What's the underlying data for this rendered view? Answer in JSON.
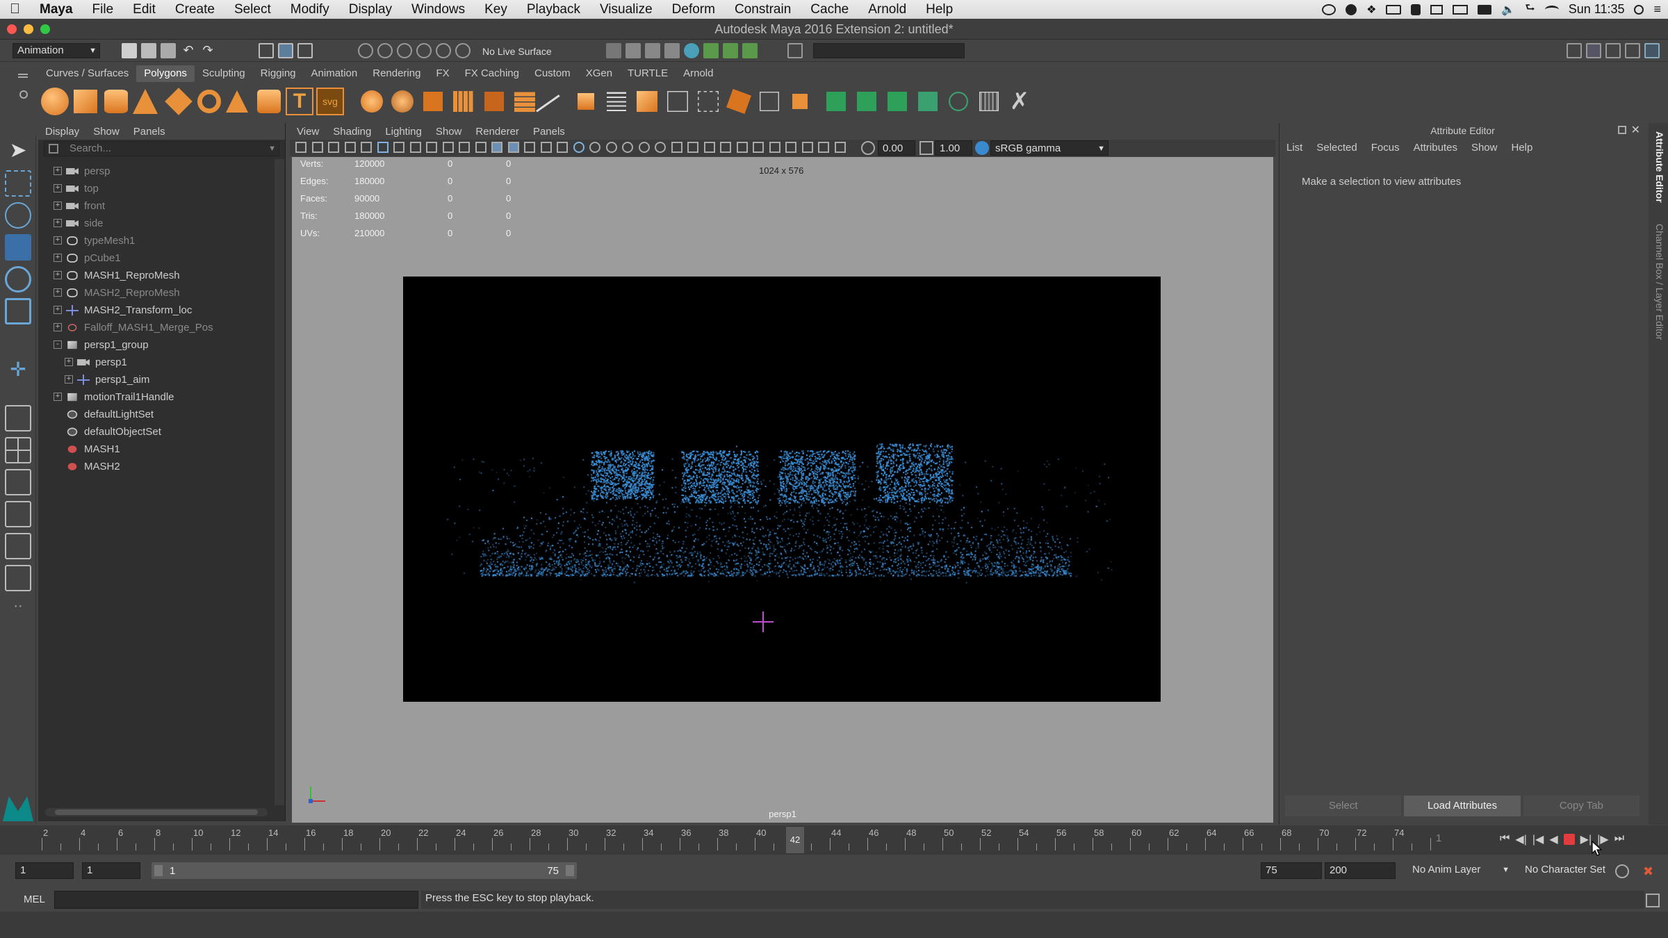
{
  "menubar": {
    "app": "Maya",
    "items": [
      "File",
      "Edit",
      "Create",
      "Select",
      "Modify",
      "Display",
      "Windows",
      "Key",
      "Playback",
      "Visualize",
      "Deform",
      "Constrain",
      "Cache",
      "Arnold",
      "Help"
    ],
    "clock": "Sun 11:35"
  },
  "window": {
    "title": "Autodesk Maya 2016 Extension 2: untitled*"
  },
  "status": {
    "mode": "Animation",
    "live_surface": "No Live Surface"
  },
  "shelf": {
    "tabs": [
      "Curves / Surfaces",
      "Polygons",
      "Sculpting",
      "Rigging",
      "Animation",
      "Rendering",
      "FX",
      "FX Caching",
      "Custom",
      "XGen",
      "TURTLE",
      "Arnold"
    ],
    "active_tab": "Polygons",
    "svg_label": "svg"
  },
  "outliner": {
    "menu": [
      "Display",
      "Show",
      "Panels"
    ],
    "search_placeholder": "Search...",
    "items": [
      {
        "label": "persp",
        "icon": "camera-icon",
        "dim": true,
        "indent": 0,
        "exp": "+"
      },
      {
        "label": "top",
        "icon": "camera-icon",
        "dim": true,
        "indent": 0,
        "exp": "+"
      },
      {
        "label": "front",
        "icon": "camera-icon",
        "dim": true,
        "indent": 0,
        "exp": "+"
      },
      {
        "label": "side",
        "icon": "camera-icon",
        "dim": true,
        "indent": 0,
        "exp": "+"
      },
      {
        "label": "typeMesh1",
        "icon": "mesh-icon",
        "dim": true,
        "indent": 0,
        "exp": "+"
      },
      {
        "label": "pCube1",
        "icon": "mesh-icon",
        "dim": true,
        "indent": 0,
        "exp": "+"
      },
      {
        "label": "MASH1_ReproMesh",
        "icon": "mesh-icon",
        "dim": false,
        "indent": 0,
        "exp": "+"
      },
      {
        "label": "MASH2_ReproMesh",
        "icon": "mesh-icon",
        "dim": true,
        "indent": 0,
        "exp": "+"
      },
      {
        "label": "MASH2_Transform_loc",
        "icon": "locator-icon",
        "dim": false,
        "indent": 0,
        "exp": "+"
      },
      {
        "label": "Falloff_MASH1_Merge_Pos",
        "icon": "falloff-icon",
        "dim": true,
        "indent": 0,
        "exp": "+"
      },
      {
        "label": "persp1_group",
        "icon": "group-icon",
        "dim": false,
        "indent": 0,
        "exp": "-"
      },
      {
        "label": "persp1",
        "icon": "camera-icon",
        "dim": false,
        "indent": 1,
        "exp": "+"
      },
      {
        "label": "persp1_aim",
        "icon": "locator-icon",
        "dim": false,
        "indent": 1,
        "exp": "+"
      },
      {
        "label": "motionTrail1Handle",
        "icon": "group-icon",
        "dim": false,
        "indent": 0,
        "exp": "+"
      },
      {
        "label": "defaultLightSet",
        "icon": "set-icon",
        "dim": false,
        "indent": 0,
        "exp": ""
      },
      {
        "label": "defaultObjectSet",
        "icon": "set-icon",
        "dim": false,
        "indent": 0,
        "exp": ""
      },
      {
        "label": "MASH1",
        "icon": "mash-icon",
        "dim": false,
        "indent": 0,
        "exp": ""
      },
      {
        "label": "MASH2",
        "icon": "mash-icon",
        "dim": false,
        "indent": 0,
        "exp": ""
      }
    ]
  },
  "viewport": {
    "menu": [
      "View",
      "Shading",
      "Lighting",
      "Show",
      "Renderer",
      "Panels"
    ],
    "field_a": "0.00",
    "field_b": "1.00",
    "color_space": "sRGB gamma",
    "resolution": "1024 x 576",
    "camera": "persp1",
    "stats": [
      {
        "label": "Verts:",
        "v1": "120000",
        "v2": "0",
        "v3": "0"
      },
      {
        "label": "Edges:",
        "v1": "180000",
        "v2": "0",
        "v3": "0"
      },
      {
        "label": "Faces:",
        "v1": "90000",
        "v2": "0",
        "v3": "0"
      },
      {
        "label": "Tris:",
        "v1": "180000",
        "v2": "0",
        "v3": "0"
      },
      {
        "label": "UVs:",
        "v1": "210000",
        "v2": "0",
        "v3": "0"
      }
    ],
    "particle_color": "#3b8fd8"
  },
  "attr_editor": {
    "title": "Attribute Editor",
    "menu": [
      "List",
      "Selected",
      "Focus",
      "Attributes",
      "Show",
      "Help"
    ],
    "message": "Make a selection to view attributes",
    "buttons": [
      "Select",
      "Load Attributes",
      "Copy Tab"
    ],
    "side_tabs": [
      "Attribute Editor",
      "Channel Box / Layer Editor"
    ]
  },
  "timeline": {
    "ticks": [
      "2",
      "4",
      "6",
      "8",
      "10",
      "12",
      "14",
      "16",
      "18",
      "20",
      "22",
      "24",
      "26",
      "28",
      "30",
      "32",
      "34",
      "36",
      "38",
      "40",
      "42",
      "44",
      "46",
      "48",
      "50",
      "52",
      "54",
      "56",
      "58",
      "60",
      "62",
      "64",
      "66",
      "68",
      "70",
      "72",
      "74"
    ],
    "current": "42",
    "current_field": "1"
  },
  "range": {
    "start": "1",
    "start2": "1",
    "slider_start": "1",
    "slider_end": "75",
    "end": "75",
    "end2": "200",
    "anim_layer": "No Anim Layer",
    "char_set": "No Character Set"
  },
  "cmd": {
    "lang": "MEL",
    "help": "Press the ESC key to stop playback."
  }
}
